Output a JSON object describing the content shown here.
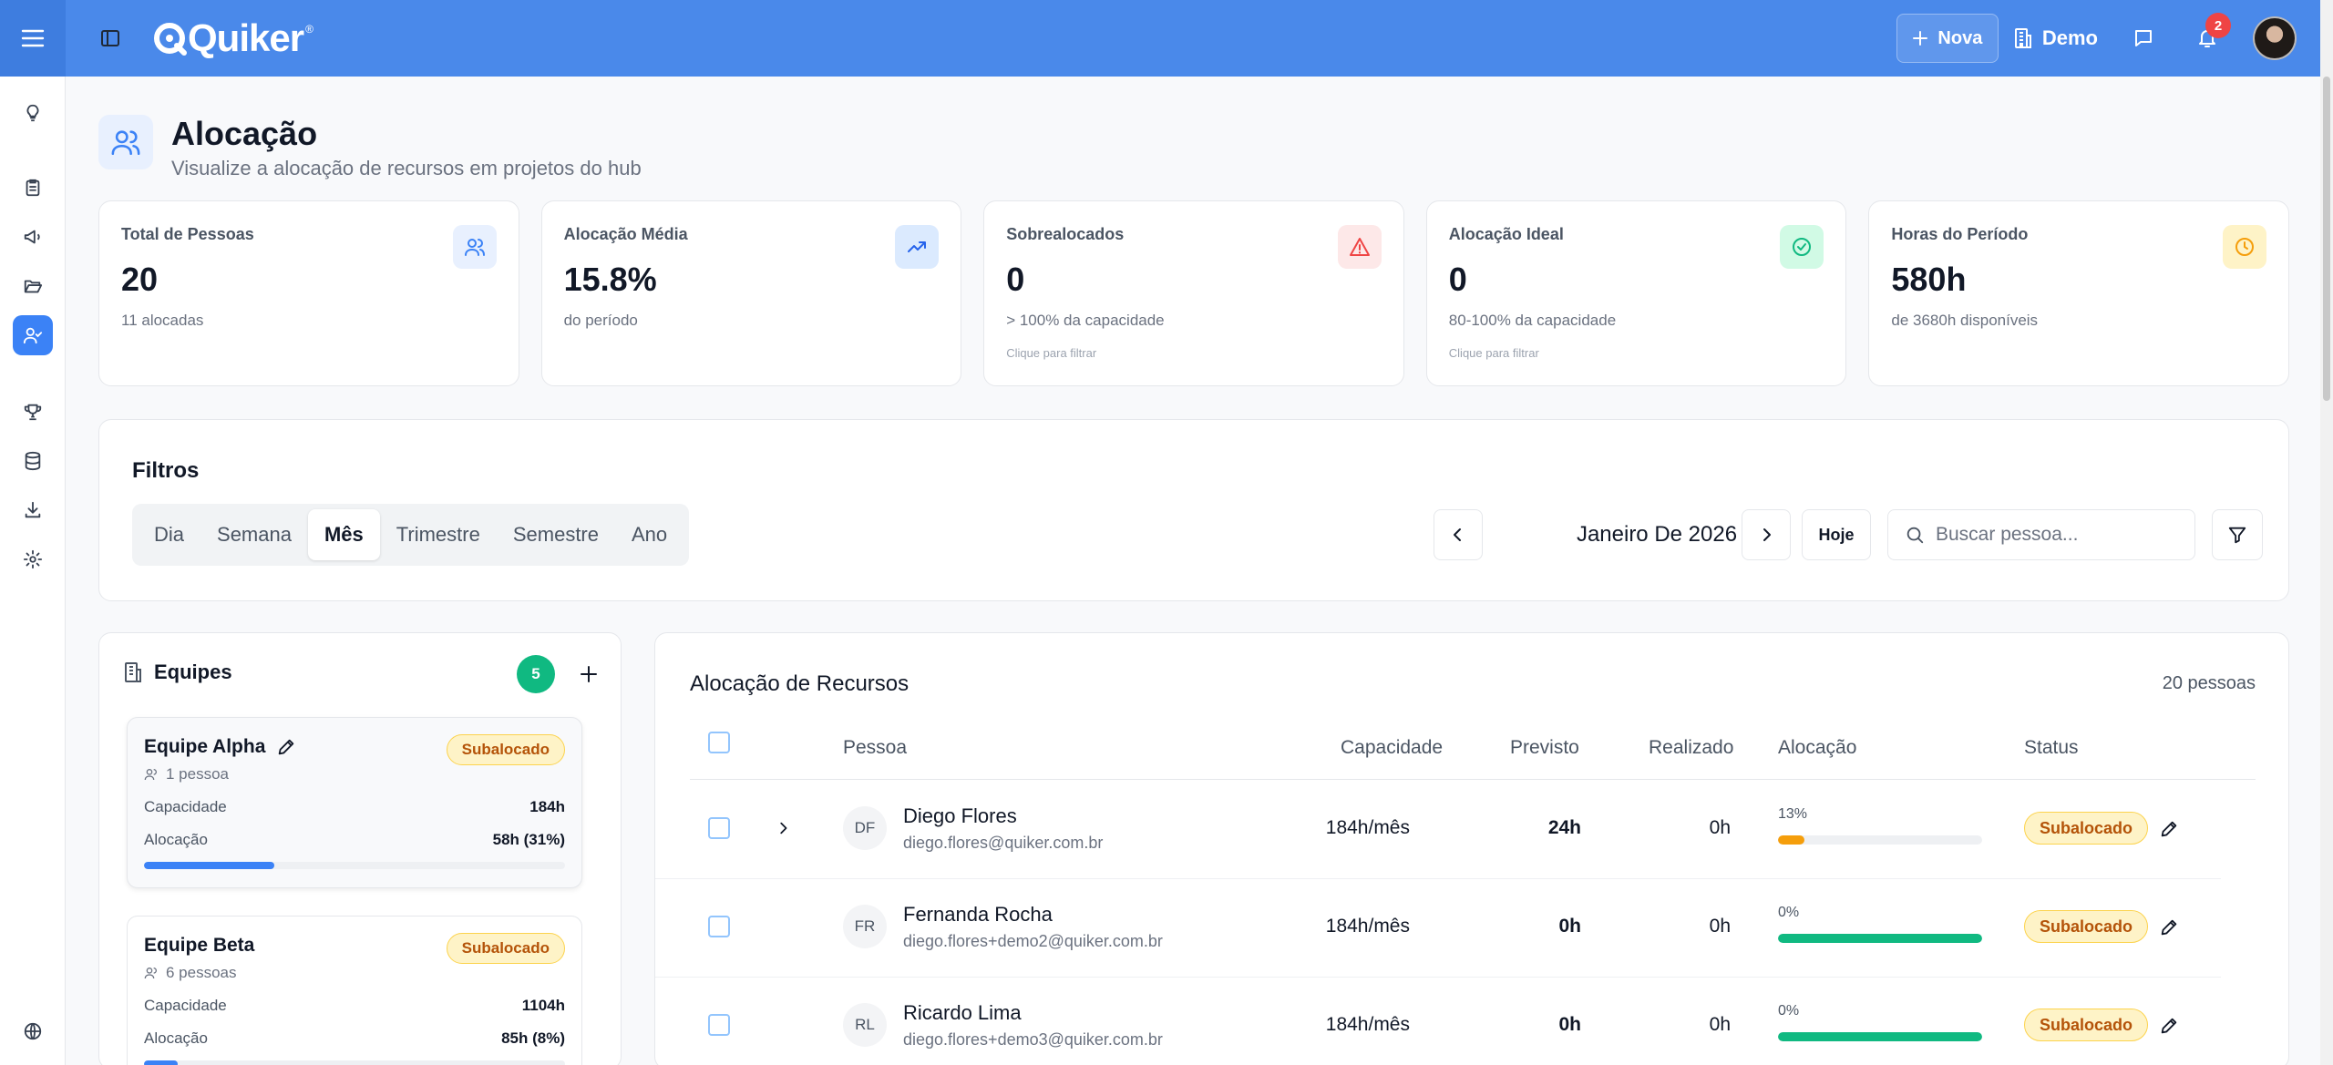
{
  "topbar": {
    "logo_text": "Quiker",
    "logo_mark": "®",
    "new_label": "Nova",
    "workspace_label": "Demo",
    "notification_count": "2"
  },
  "header": {
    "title": "Alocação",
    "subtitle": "Visualize a alocação de recursos em projetos do hub"
  },
  "stats": [
    {
      "label": "Total de Pessoas",
      "value": "20",
      "note": "11 alocadas",
      "hint": "",
      "icon": "users-icon",
      "color": "#3b82f6"
    },
    {
      "label": "Alocação Média",
      "value": "15.8%",
      "note": "do período",
      "hint": "",
      "icon": "trending-up-icon",
      "color": "#2563eb"
    },
    {
      "label": "Sobrealocados",
      "value": "0",
      "note": "> 100% da capacidade",
      "hint": "Clique para filtrar",
      "icon": "alert-triangle-icon",
      "color": "#ef4444"
    },
    {
      "label": "Alocação Ideal",
      "value": "0",
      "note": "80-100% da capacidade",
      "hint": "Clique para filtrar",
      "icon": "check-circle-icon",
      "color": "#10b981"
    },
    {
      "label": "Horas do Período",
      "value": "580h",
      "note": "de 3680h disponíveis",
      "hint": "",
      "icon": "clock-icon",
      "color": "#f59e0b"
    }
  ],
  "filters": {
    "title": "Filtros",
    "periods": [
      "Dia",
      "Semana",
      "Mês",
      "Trimestre",
      "Semestre",
      "Ano"
    ],
    "active_period": "Mês",
    "current_period": "Janeiro De 2026",
    "today_label": "Hoje",
    "search_placeholder": "Buscar pessoa...",
    "search_value": ""
  },
  "teams": {
    "title": "Equipes",
    "count": "5",
    "items": [
      {
        "name": "Equipe Alpha",
        "people": "1 pessoa",
        "status": "Subalocado",
        "capacity_label": "Capacidade",
        "capacity": "184h",
        "allocation_label": "Alocação",
        "allocation": "58h (31%)",
        "allocation_pct": 31
      },
      {
        "name": "Equipe Beta",
        "people": "6 pessoas",
        "status": "Subalocado",
        "capacity_label": "Capacidade",
        "capacity": "1104h",
        "allocation_label": "Alocação",
        "allocation": "85h (8%)",
        "allocation_pct": 8
      }
    ]
  },
  "allocation": {
    "title": "Alocação de Recursos",
    "count": "20 pessoas",
    "columns": {
      "person": "Pessoa",
      "capacity": "Capacidade",
      "planned": "Previsto",
      "actual": "Realizado",
      "allocation": "Alocação",
      "status": "Status"
    },
    "rows": [
      {
        "initials": "DF",
        "name": "Diego Flores",
        "email": "diego.flores@quiker.com.br",
        "capacity": "184h/mês",
        "planned": "24h",
        "actual": "0h",
        "pct_label": "13%",
        "pct": 13,
        "bar_color": "#f59e0b",
        "status": "Subalocado"
      },
      {
        "initials": "FR",
        "name": "Fernanda Rocha",
        "email": "diego.flores+demo2@quiker.com.br",
        "capacity": "184h/mês",
        "planned": "0h",
        "actual": "0h",
        "pct_label": "0%",
        "pct": 100,
        "bar_color": "#10b981",
        "status": "Subalocado"
      },
      {
        "initials": "RL",
        "name": "Ricardo Lima",
        "email": "diego.flores+demo3@quiker.com.br",
        "capacity": "184h/mês",
        "planned": "0h",
        "actual": "0h",
        "pct_label": "0%",
        "pct": 100,
        "bar_color": "#10b981",
        "status": "Subalocado"
      }
    ]
  }
}
